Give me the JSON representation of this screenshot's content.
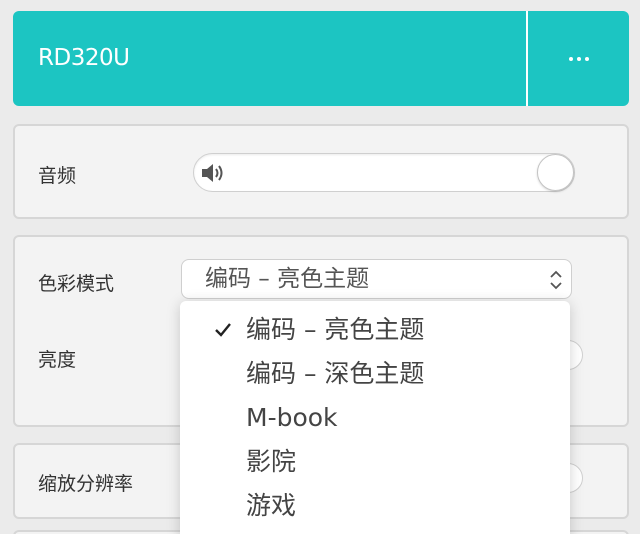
{
  "header": {
    "device_name": "RD320U",
    "menu_icon": "more-horizontal-icon"
  },
  "audio": {
    "label": "音频",
    "icon": "speaker-icon",
    "volume_level_percent": 100
  },
  "display": {
    "color_mode_label": "色彩模式",
    "color_mode_selected": "编码 – 亮色主题",
    "brightness_label": "亮度"
  },
  "scale": {
    "label": "缩放分辨率"
  },
  "dropdown": {
    "items": [
      {
        "label": "编码 – 亮色主题",
        "selected": true
      },
      {
        "label": "编码 – 深色主题",
        "selected": false
      },
      {
        "label": "M-book",
        "selected": false
      },
      {
        "label": "影院",
        "selected": false
      },
      {
        "label": "游戏",
        "selected": false
      }
    ]
  },
  "colors": {
    "accent": "#1cc5c2",
    "background": "#ebebeb",
    "card": "#f3f3f3"
  }
}
